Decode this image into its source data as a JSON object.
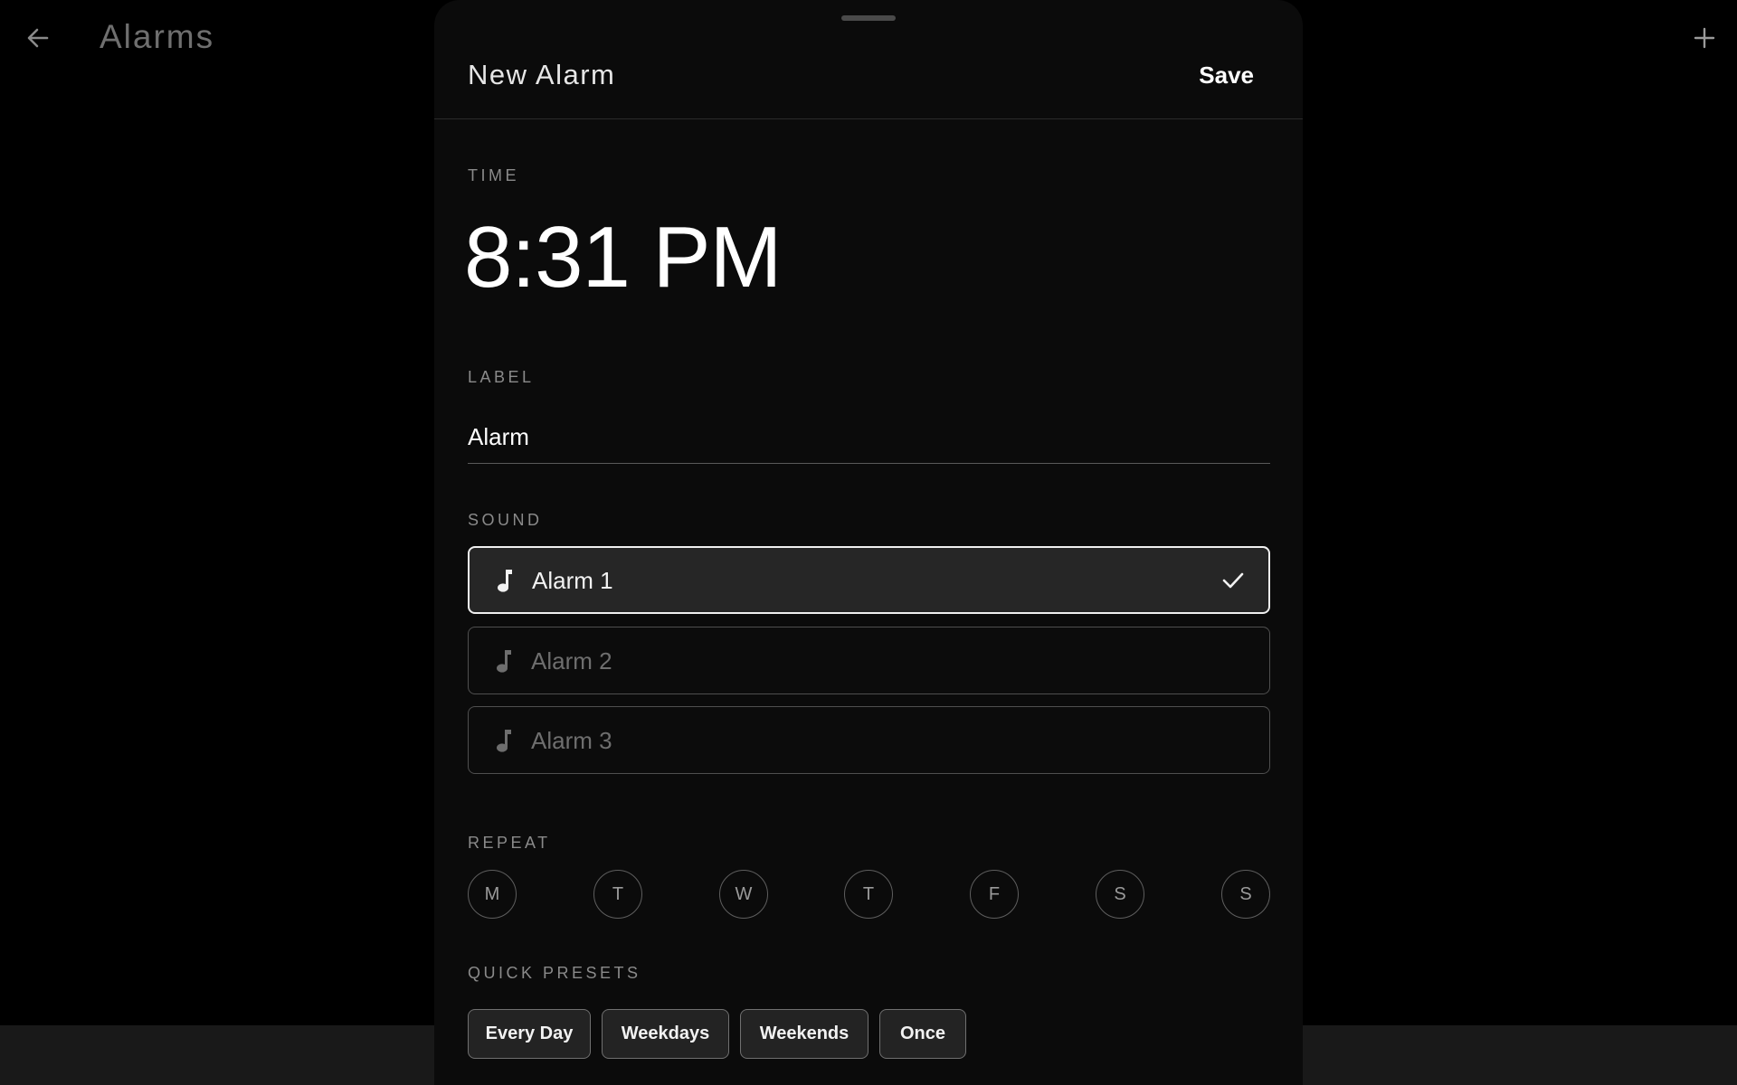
{
  "background": {
    "title": "Alarms",
    "back_icon": "arrow-left-icon",
    "add_icon": "plus-icon"
  },
  "sheet": {
    "title": "New Alarm",
    "save_label": "Save"
  },
  "time": {
    "section_label": "TIME",
    "value": "8:31 PM"
  },
  "label": {
    "section_label": "LABEL",
    "value": "Alarm"
  },
  "sound": {
    "section_label": "SOUND",
    "options": [
      {
        "name": "Alarm 1",
        "selected": true
      },
      {
        "name": "Alarm 2",
        "selected": false
      },
      {
        "name": "Alarm 3",
        "selected": false
      }
    ]
  },
  "repeat": {
    "section_label": "REPEAT",
    "days": [
      "M",
      "T",
      "W",
      "T",
      "F",
      "S",
      "S"
    ]
  },
  "presets": {
    "section_label": "QUICK PRESETS",
    "items": [
      "Every Day",
      "Weekdays",
      "Weekends",
      "Once"
    ]
  },
  "colors": {
    "background": "#000000",
    "sheet": "#0b0b0b",
    "selected_option_bg": "#262626",
    "muted_text": "#8a8a8a",
    "primary_text": "#ffffff"
  }
}
